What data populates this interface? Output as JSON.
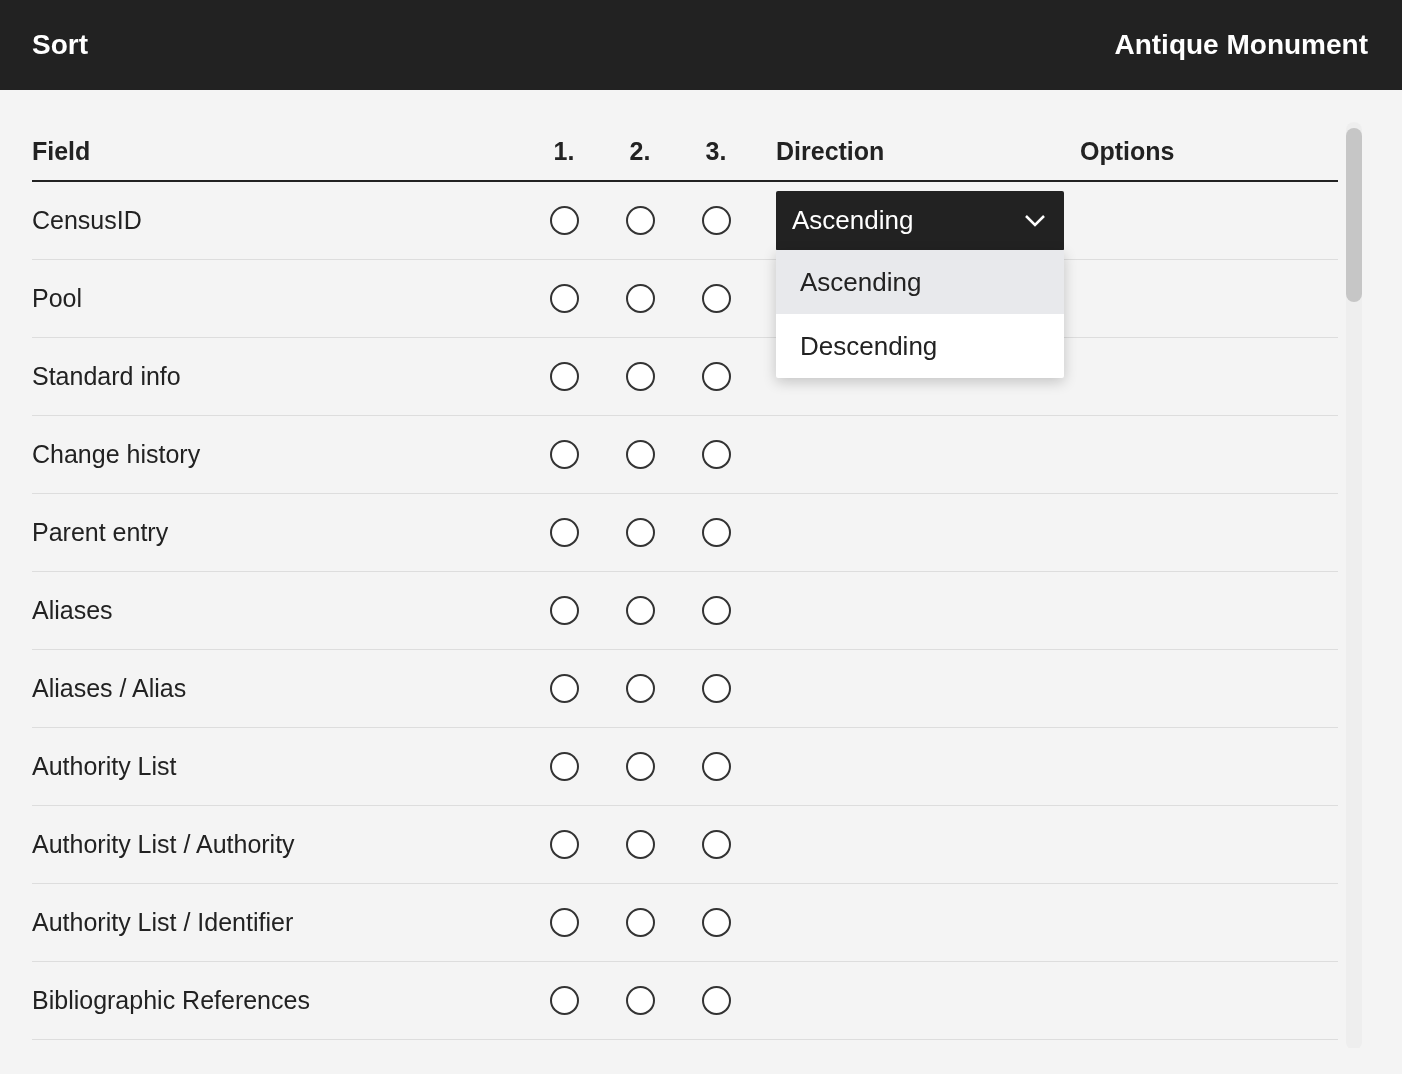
{
  "header": {
    "title": "Sort",
    "entity": "Antique Monument"
  },
  "columns": {
    "field": "Field",
    "sort_1": "1.",
    "sort_2": "2.",
    "sort_3": "3.",
    "direction": "Direction",
    "options": "Options"
  },
  "rows": [
    {
      "field": "CensusID",
      "radios": [
        {
          "selected": false
        },
        {
          "selected": false
        },
        {
          "selected": false
        }
      ],
      "direction": {
        "value": "Ascending",
        "open": true,
        "options": [
          {
            "label": "Ascending",
            "selected": true
          },
          {
            "label": "Descending",
            "selected": false
          }
        ]
      }
    },
    {
      "field": "Pool",
      "radios": [
        {
          "selected": false
        },
        {
          "selected": false
        },
        {
          "selected": false
        }
      ]
    },
    {
      "field": "Standard info",
      "radios": [
        {
          "selected": false
        },
        {
          "selected": false
        },
        {
          "selected": false
        }
      ]
    },
    {
      "field": "Change history",
      "radios": [
        {
          "selected": false
        },
        {
          "selected": false
        },
        {
          "selected": false
        }
      ]
    },
    {
      "field": "Parent entry",
      "radios": [
        {
          "selected": false
        },
        {
          "selected": false
        },
        {
          "selected": false
        }
      ]
    },
    {
      "field": "Aliases",
      "radios": [
        {
          "selected": false
        },
        {
          "selected": false
        },
        {
          "selected": false
        }
      ]
    },
    {
      "field": "Aliases / Alias",
      "radios": [
        {
          "selected": false
        },
        {
          "selected": false
        },
        {
          "selected": false
        }
      ]
    },
    {
      "field": "Authority List",
      "radios": [
        {
          "selected": false
        },
        {
          "selected": false
        },
        {
          "selected": false
        }
      ]
    },
    {
      "field": "Authority List / Authority",
      "radios": [
        {
          "selected": false
        },
        {
          "selected": false
        },
        {
          "selected": false
        }
      ]
    },
    {
      "field": "Authority List / Identifier",
      "radios": [
        {
          "selected": false
        },
        {
          "selected": false
        },
        {
          "selected": false
        }
      ]
    },
    {
      "field": "Bibliographic References",
      "radios": [
        {
          "selected": false
        },
        {
          "selected": false
        },
        {
          "selected": false
        }
      ]
    }
  ]
}
